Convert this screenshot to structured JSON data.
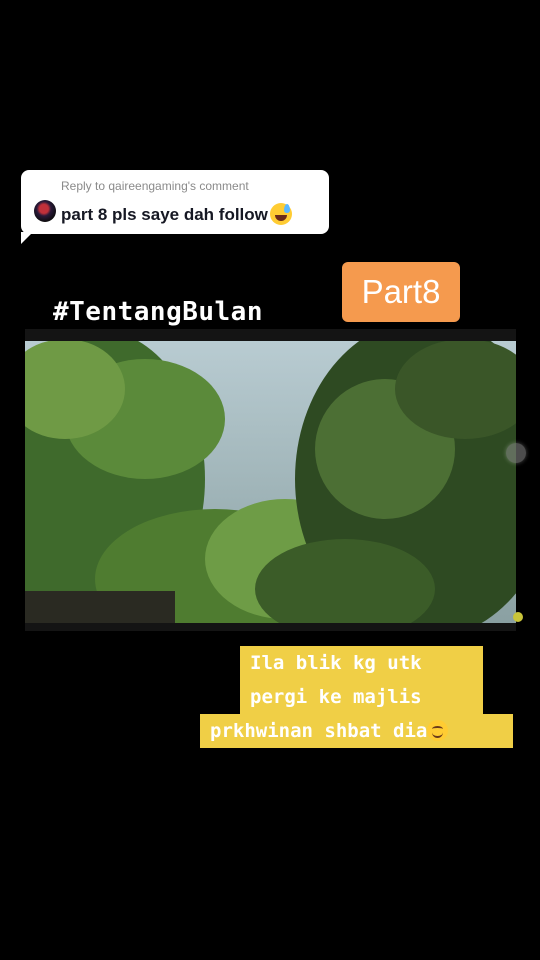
{
  "reply": {
    "header": "Reply to qaireengaming's comment",
    "text": "part 8 pls saye dah follow",
    "emoji": "sweat-smile-emoji"
  },
  "overlay": {
    "part_label": "Part8",
    "hashtag": "#TentangBulan"
  },
  "caption": {
    "lines": [
      "Ila blik kg utk",
      "pergi ke majlis",
      "prkhwinan shbat dia"
    ],
    "emoji": "smiling-face-emoji"
  },
  "colors": {
    "background": "#000000",
    "badge": "#f59a4e",
    "caption_bg": "#f0cf46",
    "bubble": "#ffffff"
  }
}
